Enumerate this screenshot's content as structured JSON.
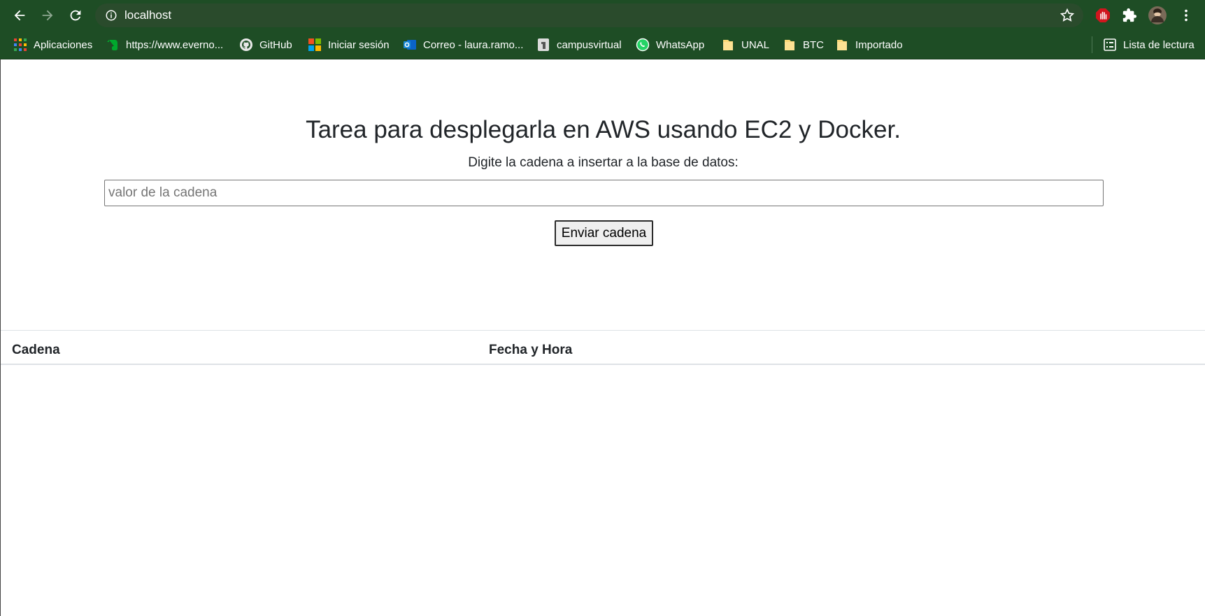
{
  "browser": {
    "url": "localhost",
    "bookmarks": [
      {
        "label": "Aplicaciones",
        "icon": "apps-grid-icon"
      },
      {
        "label": "https://www.everno...",
        "icon": "evernote-icon"
      },
      {
        "label": "GitHub",
        "icon": "github-icon"
      },
      {
        "label": "Iniciar sesión",
        "icon": "microsoft-icon"
      },
      {
        "label": "Correo - laura.ramo...",
        "icon": "outlook-icon"
      },
      {
        "label": "campusvirtual",
        "icon": "campusvirtual-icon"
      },
      {
        "label": "WhatsApp",
        "icon": "whatsapp-icon"
      },
      {
        "label": "UNAL",
        "icon": "folder-icon"
      },
      {
        "label": "BTC",
        "icon": "folder-icon"
      },
      {
        "label": "Importado",
        "icon": "folder-icon"
      }
    ],
    "reading_list": "Lista de lectura"
  },
  "page": {
    "title": "Tarea para desplegarla en AWS usando EC2 y Docker.",
    "subtitle": "Digite la cadena a insertar a la base de datos:",
    "input": {
      "value": "",
      "placeholder": "valor de la cadena"
    },
    "button_label": "Enviar cadena",
    "table": {
      "headers": [
        "Cadena",
        "Fecha y Hora"
      ],
      "rows": []
    }
  },
  "colors": {
    "chrome": "#1e4d25",
    "omnibox": "#2a4b2c",
    "text": "#212529"
  }
}
